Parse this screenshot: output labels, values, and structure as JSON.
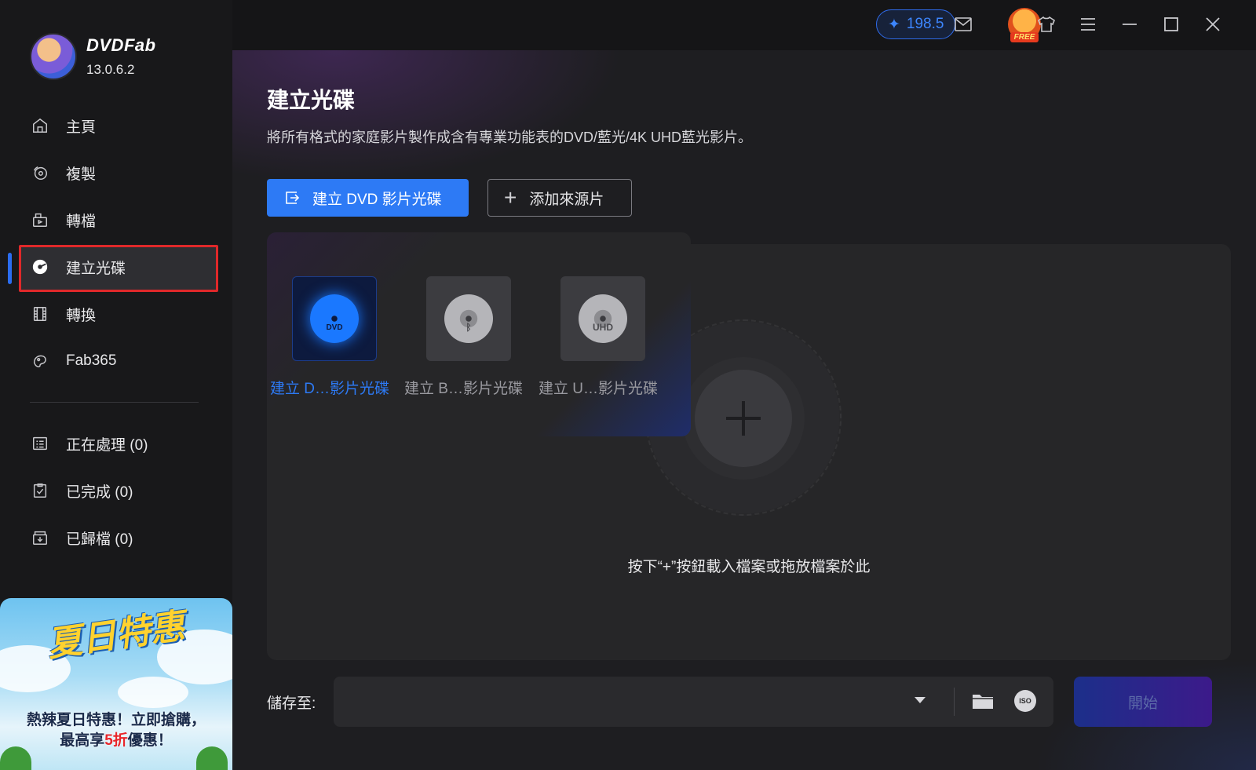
{
  "app": {
    "name": "DVDFab",
    "version": "13.0.6.2"
  },
  "sidebar": {
    "items": [
      {
        "label": "主頁",
        "icon": "home-icon"
      },
      {
        "label": "複製",
        "icon": "copy-disc-icon"
      },
      {
        "label": "轉檔",
        "icon": "ripper-icon"
      },
      {
        "label": "建立光碟",
        "icon": "creator-disc-icon",
        "active": true
      },
      {
        "label": "轉換",
        "icon": "film-icon"
      },
      {
        "label": "Fab365",
        "icon": "fab365-icon"
      }
    ],
    "queue": [
      {
        "label": "正在處理 (0)",
        "icon": "processing-list-icon"
      },
      {
        "label": "已完成 (0)",
        "icon": "completed-clipboard-icon"
      },
      {
        "label": "已歸檔 (0)",
        "icon": "archive-box-icon"
      }
    ],
    "promo": {
      "title": "夏日特惠",
      "line1": "熱辣夏日特惠！立即搶購，",
      "line2_pre": "最高享",
      "line2_highlight": "5折",
      "line2_post": "優惠！"
    }
  },
  "topbar": {
    "credits": "198.5",
    "gift_badge": "FREE"
  },
  "main": {
    "title": "建立光碟",
    "description": "將所有格式的家庭影片製作成含有專業功能表的DVD/藍光/4K UHD藍光影片。",
    "primary_button": "建立 DVD 影片光碟",
    "add_source_button": "添加來源片",
    "disc_options": [
      {
        "label": "建立 D…影片光碟",
        "badge": "DVD",
        "selected": true
      },
      {
        "label": "建立 B…影片光碟",
        "badge": "",
        "selected": false
      },
      {
        "label": "建立 U…影片光碟",
        "badge": "UHD",
        "selected": false
      }
    ],
    "drop_hint": "按下“+”按鈕載入檔案或拖放檔案於此"
  },
  "footer": {
    "save_label": "儲存至:",
    "save_value": "",
    "iso_label": "ISO",
    "start_button": "開始"
  },
  "colors": {
    "accent": "#2d7af5",
    "active_border": "#e0282a",
    "credits": "#3d86ff"
  }
}
